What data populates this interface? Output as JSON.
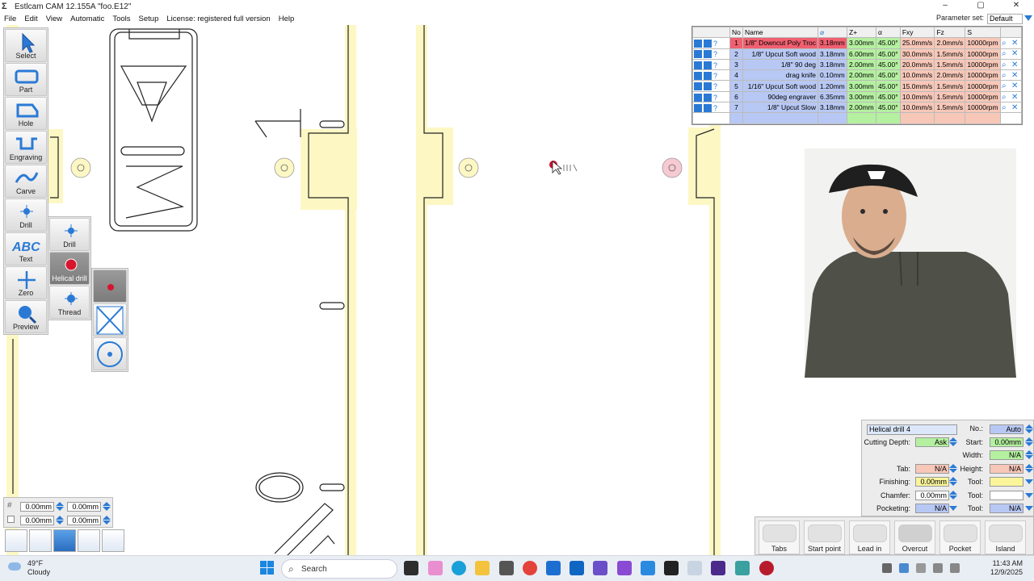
{
  "window": {
    "title": "Estlcam CAM 12.155A \"foo.E12\"",
    "controls": [
      "–",
      "▢",
      "✕"
    ]
  },
  "menu": {
    "items": [
      "File",
      "Edit",
      "View",
      "Automatic",
      "Tools",
      "Setup",
      "License: registered full version",
      "Help"
    ],
    "parameter_set_label": "Parameter set:",
    "parameter_set_value": "Default"
  },
  "toolbar": {
    "buttons": [
      {
        "label": "Select",
        "icon": "cursor-arrow-icon"
      },
      {
        "label": "Part",
        "icon": "part-outline-icon"
      },
      {
        "label": "Hole",
        "icon": "hole-outline-icon"
      },
      {
        "label": "Engraving",
        "icon": "engraving-icon"
      },
      {
        "label": "Carve",
        "icon": "carve-wave-icon"
      },
      {
        "label": "Drill",
        "icon": "drill-point-icon"
      },
      {
        "label": "Text",
        "icon": "abc-text-icon"
      },
      {
        "label": "Zero",
        "icon": "zero-crosshair-icon"
      },
      {
        "label": "Preview",
        "icon": "magnifier-preview-icon"
      }
    ]
  },
  "drill_flyout": {
    "buttons": [
      {
        "label": "Drill",
        "icon": "drill-point-icon"
      },
      {
        "label": "Helical drill",
        "icon": "helical-drill-icon",
        "selected": true
      },
      {
        "label": "Thread",
        "icon": "thread-icon"
      }
    ],
    "sub_buttons": [
      {
        "icon": "red-dot-icon",
        "selected": true
      },
      {
        "icon": "cross-diagonal-icon"
      },
      {
        "icon": "circle-target-icon"
      }
    ]
  },
  "tool_table": {
    "headers": [
      "No",
      "Name",
      "⌀",
      "Z+",
      "α",
      "Fxy",
      "Fz",
      "S"
    ],
    "rows": [
      {
        "no": "1",
        "name": "1/8\" Downcut Poly Troc",
        "dia": "3.18mm",
        "z": "3.00mm",
        "angle": "45.00°",
        "fxy": "25.0mm/s",
        "fz": "2.0mm/s",
        "s": "10000rpm",
        "selected": true
      },
      {
        "no": "2",
        "name": "1/8\" Upcut Soft wood",
        "dia": "3.18mm",
        "z": "6.00mm",
        "angle": "45.00°",
        "fxy": "30.0mm/s",
        "fz": "1.5mm/s",
        "s": "10000rpm"
      },
      {
        "no": "3",
        "name": "1/8\" 90 deg",
        "dia": "3.18mm",
        "z": "2.00mm",
        "angle": "45.00°",
        "fxy": "20.0mm/s",
        "fz": "1.5mm/s",
        "s": "10000rpm"
      },
      {
        "no": "4",
        "name": "drag knife",
        "dia": "0.10mm",
        "z": "2.00mm",
        "angle": "45.00°",
        "fxy": "10.0mm/s",
        "fz": "2.0mm/s",
        "s": "10000rpm"
      },
      {
        "no": "5",
        "name": "1/16\" Upcut Soft wood",
        "dia": "1.20mm",
        "z": "3.00mm",
        "angle": "45.00°",
        "fxy": "15.0mm/s",
        "fz": "1.5mm/s",
        "s": "10000rpm"
      },
      {
        "no": "6",
        "name": "90deg engraver",
        "dia": "6.35mm",
        "z": "3.00mm",
        "angle": "45.00°",
        "fxy": "10.0mm/s",
        "fz": "1.5mm/s",
        "s": "10000rpm"
      },
      {
        "no": "7",
        "name": "1/8\" Upcut Slow",
        "dia": "3.18mm",
        "z": "2.00mm",
        "angle": "45.00°",
        "fxy": "10.0mm/s",
        "fz": "1.5mm/s",
        "s": "10000rpm"
      }
    ]
  },
  "properties": {
    "name": "Helical drill 4",
    "no_label": "No.:",
    "no_value": "Auto",
    "cutting_depth_label": "Cutting Depth:",
    "cutting_depth_value": "Ask",
    "start_label": "Start:",
    "start_value": "0.00mm",
    "width_label": "Width:",
    "width_value": "N/A",
    "tab_label": "Tab:",
    "tab_value": "N/A",
    "height_label": "Height:",
    "height_value": "N/A",
    "finishing_label": "Finishing:",
    "finishing_value": "0.00mm",
    "tool1_label": "Tool:",
    "chamfer_label": "Chamfer:",
    "chamfer_value": "0.00mm",
    "tool2_label": "Tool:",
    "pocketing_label": "Pocketing:",
    "pocketing_value": "N/A",
    "tool3_label": "Tool:",
    "tool3_value": "N/A"
  },
  "bottom_tabs": [
    "Tabs",
    "Start point",
    "Lead in",
    "Overcut",
    "Pocket",
    "Island"
  ],
  "coords": {
    "x1": "0.00mm",
    "x2": "0.00mm",
    "y1": "0.00mm",
    "y2": "0.00mm"
  },
  "taskbar": {
    "weather_temp": "49°F",
    "weather_desc": "Cloudy",
    "search_placeholder": "Search",
    "time": "11:43 AM",
    "date": "12/9/2025"
  },
  "colors": {
    "selected_row": "#f06070",
    "green_cell": "#b4f0a0",
    "pink_cell": "#f7c7b8",
    "blue_cell": "#b8c8f4",
    "part_fill": "#fdf7c4",
    "accent_blue": "#2a7ad5"
  }
}
